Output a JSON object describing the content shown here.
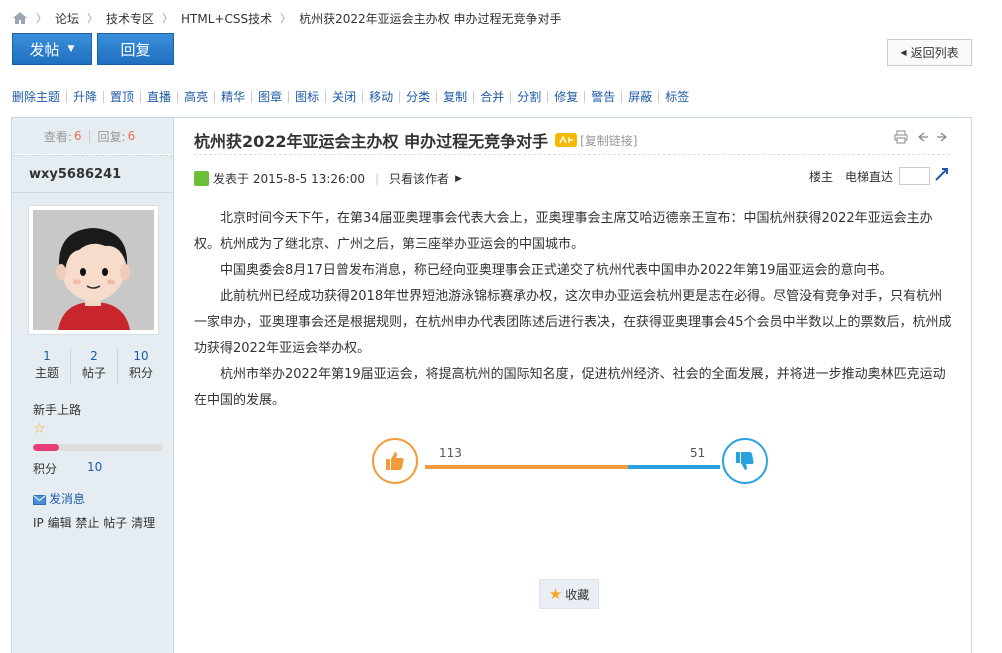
{
  "breadcrumb": {
    "items": [
      "论坛",
      "技术专区",
      "HTML+CSS技术",
      "杭州获2022年亚运会主办权 申办过程无竞争对手"
    ]
  },
  "actions": {
    "post_label": "发帖",
    "reply_label": "回复",
    "back_label": "返回列表"
  },
  "mod_tools": [
    "删除主题",
    "升降",
    "置顶",
    "直播",
    "高亮",
    "精华",
    "图章",
    "图标",
    "关闭",
    "移动",
    "分类",
    "复制",
    "合并",
    "分割",
    "修复",
    "警告",
    "屏蔽",
    "标签"
  ],
  "sidebar": {
    "views_label": "查看:",
    "views": "6",
    "replies_label": "回复:",
    "replies": "6",
    "username": "wxy5686241",
    "stats": [
      {
        "value": "1",
        "label": "主题"
      },
      {
        "value": "2",
        "label": "帖子"
      },
      {
        "value": "10",
        "label": "积分"
      }
    ],
    "rank": "新手上路",
    "level_progress": 0.2,
    "points_label": "积分",
    "points_value": "10",
    "message_label": "发消息",
    "admin_links": [
      "IP",
      "编辑",
      "禁止",
      "帖子",
      "清理"
    ]
  },
  "post": {
    "title": "杭州获2022年亚运会主办权 申办过程无竞争对手",
    "copy_link": "[复制链接]",
    "published": "发表于 2015-8-5 13:26:00",
    "only_author": "只看该作者",
    "floor_owner": "楼主",
    "floor_jump_label": "电梯直达",
    "paragraphs": [
      "北京时间今天下午，在第34届亚奥理事会代表大会上，亚奥理事会主席艾哈迈德亲王宣布：中国杭州获得2022年亚运会主办权。杭州成为了继北京、广州之后，第三座举办亚运会的中国城市。",
      "中国奥委会8月17日曾发布消息，称已经向亚奥理事会正式递交了杭州代表中国申办2022年第19届亚运会的意向书。",
      "此前杭州已经成功获得2018年世界短池游泳锦标赛承办权，这次申办亚运会杭州更是志在必得。尽管没有竞争对手，只有杭州一家申办，亚奥理事会还是根据规则，在杭州申办代表团陈述后进行表决，在获得亚奥理事会45个会员中半数以上的票数后，杭州成功获得2022年亚运会举办权。",
      "杭州市举办2022年第19届亚运会，将提高杭州的国际知名度，促进杭州经济、社会的全面发展，并将进一步推动奥林匹克运动在中国的发展。"
    ],
    "votes_up": "113",
    "votes_down": "51",
    "favorite_label": "收藏"
  },
  "colors": {
    "primary_button": "#2a7fd0",
    "link": "#1f5ba8",
    "up_vote": "#f39c3c",
    "down_vote": "#29a2e0",
    "sidebar_bg": "#e5edf2"
  }
}
